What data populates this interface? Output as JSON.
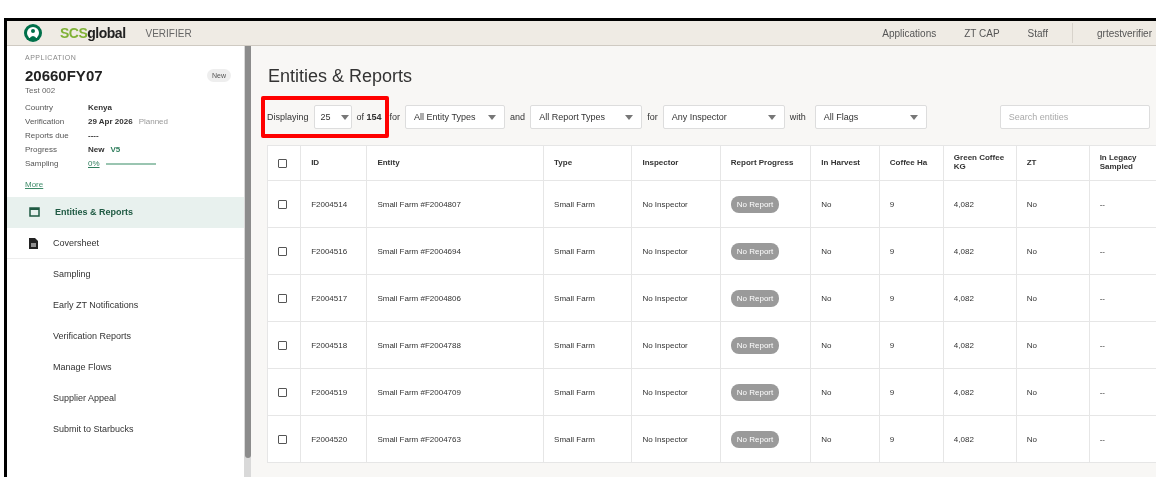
{
  "header": {
    "brand": "SCSglobal",
    "role": "VERIFIER",
    "nav": [
      "Applications",
      "ZT CAP",
      "Staff"
    ],
    "user": "grtestverifier"
  },
  "application": {
    "label": "APPLICATION",
    "number": "20660FY07",
    "status": "New",
    "name": "Test 002",
    "details": [
      {
        "kind": "text",
        "label": "Country",
        "value": "Kenya"
      },
      {
        "kind": "date",
        "label": "Verification",
        "value": "29 Apr 2026",
        "note": "Planned"
      },
      {
        "kind": "text",
        "label": "Reports due",
        "value": "----"
      },
      {
        "kind": "version",
        "label": "Progress",
        "value": "New",
        "note": "V5"
      },
      {
        "kind": "meter",
        "label": "Sampling",
        "value": "0%",
        "level": 0
      }
    ],
    "more": "More"
  },
  "nav": [
    {
      "kind": "page",
      "label": "Entities & Reports",
      "selected": true
    },
    {
      "kind": "document",
      "label": "Coversheet",
      "selected": false
    },
    {
      "kind": "sub",
      "label": "Sampling",
      "selected": false
    },
    {
      "kind": "sub",
      "label": "Early ZT Notifications",
      "selected": false
    },
    {
      "kind": "sub",
      "label": "Verification Reports",
      "selected": false
    },
    {
      "kind": "sub",
      "label": "Manage Flows",
      "selected": false
    },
    {
      "kind": "sub",
      "label": "Supplier Appeal",
      "selected": false
    },
    {
      "kind": "sub",
      "label": "Submit to Starbucks",
      "selected": false
    }
  ],
  "title": "Entities & Reports",
  "filters": {
    "displaying": "Displaying",
    "page_size": "25",
    "of": "of",
    "total": "154",
    "for1": "for",
    "entity_type": "All Entity Types",
    "and": "and",
    "report_type": "All Report Types",
    "for2": "for",
    "inspector": "Any Inspector",
    "with": "with",
    "flags": "All Flags",
    "search_placeholder": "Search entities"
  },
  "table": {
    "select_all_checked": false,
    "columns": [
      "ID",
      "Entity",
      "Type",
      "Inspector",
      "Report Progress",
      "In Harvest",
      "Coffee Ha",
      "Green Coffee KG",
      "ZT",
      "In Legacy Sampled"
    ],
    "rows": [
      {
        "checked": false,
        "id": "F2004514",
        "entity": "Small Farm #F2004807",
        "type": "Small Farm",
        "inspector": "No Inspector",
        "progress": "No Report",
        "harvest": "No",
        "ha": "9",
        "kg": "4,082",
        "zt": "No",
        "legacy": "--"
      },
      {
        "checked": false,
        "id": "F2004516",
        "entity": "Small Farm #F2004694",
        "type": "Small Farm",
        "inspector": "No Inspector",
        "progress": "No Report",
        "harvest": "No",
        "ha": "9",
        "kg": "4,082",
        "zt": "No",
        "legacy": "--"
      },
      {
        "checked": false,
        "id": "F2004517",
        "entity": "Small Farm #F2004806",
        "type": "Small Farm",
        "inspector": "No Inspector",
        "progress": "No Report",
        "harvest": "No",
        "ha": "9",
        "kg": "4,082",
        "zt": "No",
        "legacy": "--"
      },
      {
        "checked": false,
        "id": "F2004518",
        "entity": "Small Farm #F2004788",
        "type": "Small Farm",
        "inspector": "No Inspector",
        "progress": "No Report",
        "harvest": "No",
        "ha": "9",
        "kg": "4,082",
        "zt": "No",
        "legacy": "--"
      },
      {
        "checked": false,
        "id": "F2004519",
        "entity": "Small Farm #F2004709",
        "type": "Small Farm",
        "inspector": "No Inspector",
        "progress": "No Report",
        "harvest": "No",
        "ha": "9",
        "kg": "4,082",
        "zt": "No",
        "legacy": "--"
      },
      {
        "checked": false,
        "id": "F2004520",
        "entity": "Small Farm #F2004763",
        "type": "Small Farm",
        "inspector": "No Inspector",
        "progress": "No Report",
        "harvest": "No",
        "ha": "9",
        "kg": "4,082",
        "zt": "No",
        "legacy": "--"
      }
    ]
  }
}
